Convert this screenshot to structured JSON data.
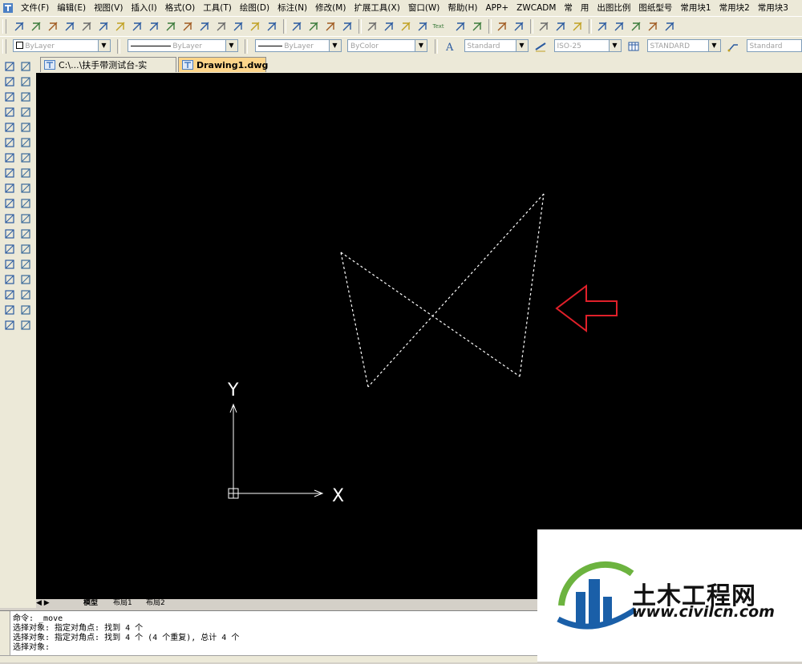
{
  "menubar": {
    "items": [
      "文件(F)",
      "编辑(E)",
      "视图(V)",
      "插入(I)",
      "格式(O)",
      "工具(T)",
      "绘图(D)",
      "标注(N)",
      "修改(M)",
      "扩展工具(X)",
      "窗口(W)",
      "帮助(H)",
      "APP+",
      "ZWCADM",
      "常",
      "用",
      "出图比例",
      "图纸型号",
      "常用块1",
      "常用块2",
      "常用块3"
    ]
  },
  "properties_toolbar": {
    "layer_value": "ByLayer",
    "linetype_value": "ByLayer",
    "lineweight_value": "ByLayer",
    "color_value": "ByColor",
    "text_style_value": "Standard",
    "dim_style_value": "ISO-25",
    "table_style_value": "STANDARD",
    "multileader_style_value": "Standard",
    "text_button_label": "Text"
  },
  "tabs": [
    {
      "label": "C:\\...\\扶手带测试台-实机.dwg",
      "active": false
    },
    {
      "label": "Drawing1.dwg",
      "active": true
    }
  ],
  "layout_tabs": [
    "模型",
    "布局1",
    "布局2"
  ],
  "ucs": {
    "x_label": "X",
    "y_label": "Y"
  },
  "command_lines": [
    "命令: _move",
    "选择对象: 指定对角点: 找到 4 个",
    "选择对象: 指定对角点: 找到 4 个 (4 个重复), 总计 4 个",
    "选择对象:"
  ],
  "watermark": {
    "cn_text": "土木工程网",
    "url_text": "www.civilcn.com"
  },
  "colors": {
    "canvas_bg": "#000000",
    "annotation_arrow": "#e0202a",
    "active_tab": "#fdd58a",
    "watermark_blue": "#1a5fa8",
    "watermark_green": "#6cb33f"
  }
}
